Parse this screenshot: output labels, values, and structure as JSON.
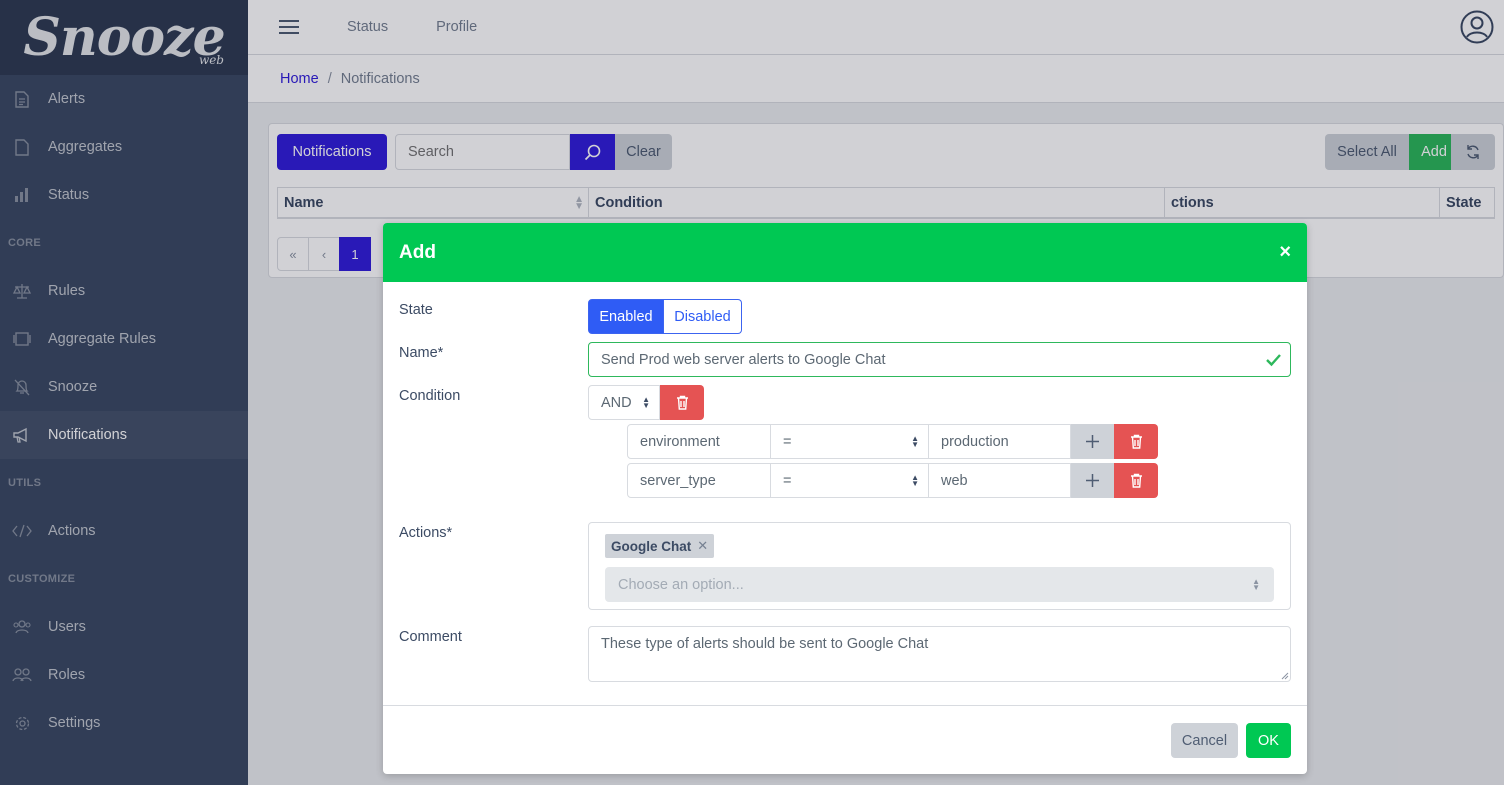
{
  "brand": {
    "name": "Snooze",
    "sub": "web"
  },
  "sidebar": {
    "items": [
      {
        "label": "Alerts",
        "icon": "document-icon"
      },
      {
        "label": "Aggregates",
        "icon": "file-icon"
      },
      {
        "label": "Status",
        "icon": "bar-chart-icon"
      }
    ],
    "core_title": "CORE",
    "core_items": [
      {
        "label": "Rules",
        "icon": "balance-scale-icon"
      },
      {
        "label": "Aggregate Rules",
        "icon": "layers-icon"
      },
      {
        "label": "Snooze",
        "icon": "bell-off-icon"
      },
      {
        "label": "Notifications",
        "icon": "megaphone-icon",
        "active": true
      }
    ],
    "utils_title": "UTILS",
    "utils_items": [
      {
        "label": "Actions",
        "icon": "code-icon"
      }
    ],
    "customize_title": "CUSTOMIZE",
    "customize_items": [
      {
        "label": "Users",
        "icon": "users-icon"
      },
      {
        "label": "Roles",
        "icon": "people-icon"
      },
      {
        "label": "Settings",
        "icon": "gear-icon"
      }
    ]
  },
  "header": {
    "links": [
      "Status",
      "Profile"
    ]
  },
  "breadcrumb": {
    "home": "Home",
    "separator": "/",
    "current": "Notifications"
  },
  "toolbar": {
    "notifications_label": "Notifications",
    "search_placeholder": "Search",
    "clear_label": "Clear",
    "select_all_label": "Select All",
    "add_label": "Add"
  },
  "table": {
    "columns": [
      "Name",
      "Condition",
      "ctions",
      "State"
    ]
  },
  "pagination": {
    "first": "«",
    "prev": "‹",
    "current": "1"
  },
  "modal": {
    "title": "Add",
    "close": "×",
    "labels": {
      "state": "State",
      "name": "Name*",
      "condition": "Condition",
      "actions": "Actions*",
      "comment": "Comment"
    },
    "state": {
      "enabled": "Enabled",
      "disabled": "Disabled",
      "selected": "Enabled"
    },
    "name_value": "Send Prod web server alerts to Google Chat",
    "condition": {
      "operator": "AND",
      "rows": [
        {
          "field": "environment",
          "op": "=",
          "value": "production"
        },
        {
          "field": "server_type",
          "op": "=",
          "value": "web"
        }
      ]
    },
    "actions": {
      "tags": [
        "Google Chat"
      ],
      "placeholder": "Choose an option..."
    },
    "comment_value": "These type of alerts should be sent to Google Chat",
    "cancel_label": "Cancel",
    "ok_label": "OK"
  },
  "colors": {
    "sidebar_bg": "#3c4b64",
    "primary": "#321fdb",
    "success": "#00c853",
    "danger": "#e55353"
  }
}
